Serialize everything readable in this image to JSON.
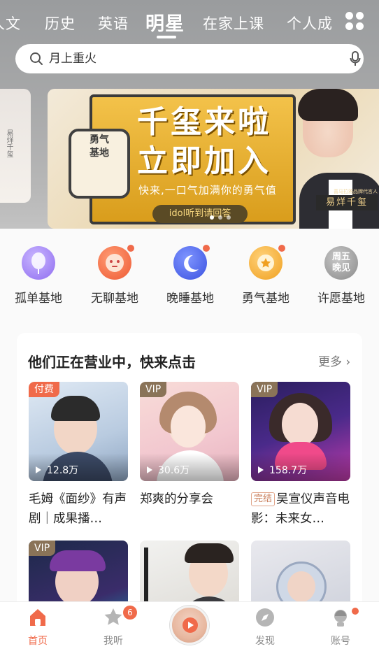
{
  "header": {
    "tabs": [
      {
        "label": "人文"
      },
      {
        "label": "历史"
      },
      {
        "label": "英语"
      },
      {
        "label": "明星",
        "active": true
      },
      {
        "label": "在家上课"
      },
      {
        "label": "个人成"
      }
    ],
    "search_placeholder": "月上重火"
  },
  "banner": {
    "badge": "勇气基地",
    "headline_line1": "千玺来啦",
    "headline_line2": "立即加入",
    "subline": "快来,一口气加满你的勇气值",
    "pill": "idol听到请回答",
    "star_tag": "喜马拉雅品牌代言人",
    "star_name": "易烊千玺",
    "left_peek_text": "易烊千玺"
  },
  "categories": [
    {
      "label": "孤单基地",
      "color": "#9b7cf0",
      "has_dot": false
    },
    {
      "label": "无聊基地",
      "color": "#f07a4a",
      "has_dot": true
    },
    {
      "label": "晚睡基地",
      "color": "#4e6af0",
      "has_dot": true
    },
    {
      "label": "勇气基地",
      "color": "#f5b030",
      "has_dot": true
    },
    {
      "label": "许愿基地",
      "icon_text": "周五晚见",
      "color": "#8a8a8a",
      "has_dot": false
    }
  ],
  "section": {
    "title": "他们正在营业中，快来点击",
    "more": "更多 ›"
  },
  "items": [
    {
      "tag": "付费",
      "tag_type": "paid",
      "plays": "12.8万",
      "title": "毛姆《面纱》有声剧｜成果播…"
    },
    {
      "tag": "VIP",
      "tag_type": "vip",
      "plays": "30.6万",
      "title": "郑爽的分享会"
    },
    {
      "tag": "VIP",
      "tag_type": "vip",
      "plays": "158.7万",
      "status": "完结",
      "title": "吴宣仪声音电影：未来女…"
    },
    {
      "tag": "VIP",
      "tag_type": "vip"
    },
    {
      "tag": "",
      "tag_type": "none"
    },
    {
      "tag": "",
      "tag_type": "none"
    }
  ],
  "bottom_nav": {
    "home": "首页",
    "mine": "我听",
    "mine_badge": "6",
    "discover": "发现",
    "account": "账号"
  },
  "colors": {
    "accent": "#f06a4a",
    "vip_tag": "#8a7358"
  }
}
